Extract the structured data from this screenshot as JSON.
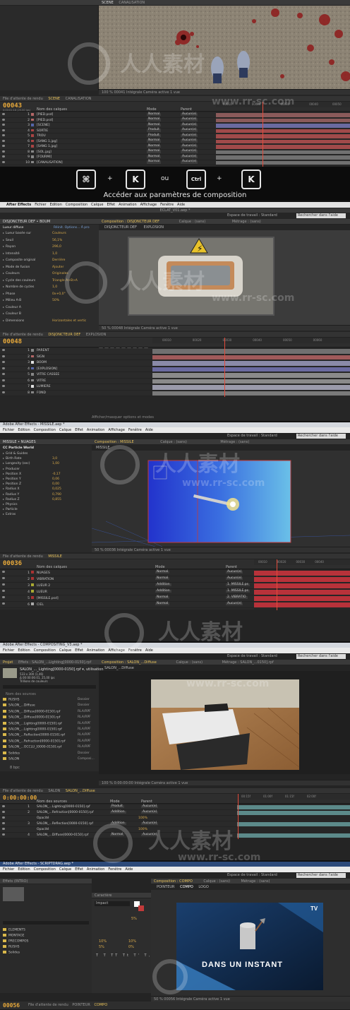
{
  "shot1": {
    "viewer_tabs": [
      "SCENE",
      "CANALISATION"
    ],
    "viewer_bar": "100 %   00041   Intégrale   Caméra active   1 vue",
    "timeline_tabs": [
      "File d'attente de rendu",
      "SCENE",
      "CANALISATION"
    ],
    "timecode": "00043",
    "timecode_sub": "0:00:01:18 (25.00 ips)",
    "col_headers": {
      "name": "Nom des calques",
      "mode": "Mode",
      "parent": "Parent"
    },
    "layers": [
      {
        "num": "1",
        "name": "[PIED.psd]",
        "mode": "Normal",
        "parent": "Aucun(e)",
        "color": "#b36666"
      },
      {
        "num": "2",
        "name": "[PIED.psd]",
        "mode": "Normal",
        "parent": "Aucun(e)",
        "color": "#b36666"
      },
      {
        "num": "3",
        "name": "[SCENE]",
        "mode": "Normal",
        "parent": "Aucun(e)",
        "color": "#5566aa"
      },
      {
        "num": "4",
        "name": "SORTIE",
        "mode": "Produit",
        "parent": "Aucun(e)",
        "color": "#aa4444"
      },
      {
        "num": "5",
        "name": "TROU",
        "mode": "Produit",
        "parent": "Aucun(e)",
        "color": "#aa4444"
      },
      {
        "num": "6",
        "name": "[SANG 1.jpg]",
        "mode": "Normal",
        "parent": "Aucun(e)",
        "color": "#aa4444"
      },
      {
        "num": "7",
        "name": "[SANG 1.jpg]",
        "mode": "Normal",
        "parent": "Aucun(e)",
        "color": "#aa4444"
      },
      {
        "num": "8",
        "name": "[SOL.jpg]",
        "mode": "Normal",
        "parent": "Aucun(e)",
        "color": "#888888"
      },
      {
        "num": "9",
        "name": "[FOURMI]",
        "mode": "Normal",
        "parent": "Aucun(e)",
        "color": "#888888"
      },
      {
        "num": "10",
        "name": "[CANALISATION]",
        "mode": "Normal",
        "parent": "Aucun(e)",
        "color": "#888888"
      }
    ],
    "bar_colors": [
      "#8a5a5a",
      "#8a5a5a",
      "#6a6aa0",
      "#a04a4a",
      "#a04a4a",
      "#a04a4a",
      "#a04a4a",
      "#707070",
      "#707070",
      "#707070"
    ],
    "shortcut": {
      "keys": [
        "⌘",
        "K",
        "Ctrl",
        "K"
      ],
      "plus": "+",
      "or": "ou",
      "caption": "Accéder aux paramètres de composition"
    }
  },
  "shot2": {
    "menu": [
      "",
      "After Effects",
      "Fichier",
      "Edition",
      "Composition",
      "Calque",
      "Effet",
      "Animation",
      "Affichage",
      "Fenêtre",
      "Aide"
    ],
    "title": "ECLAT_V01.aep *",
    "workspace": "Espace de travail : Standard",
    "search": "Rechercher dans l'aide",
    "effects_tab": "DISJONCTEUR DEF • BOUM",
    "viewer_tabs": [
      "Composition : DISJONCTEUR DEF",
      "Calque : (sans)",
      "Métrage : (sans)"
    ],
    "viewer_subtabs": [
      "DISJONCTEUR DEF",
      "EXPLOSION"
    ],
    "effect_name": "Lueur diffuse",
    "effect_links": "Réinit.  Options...  À pro",
    "properties": [
      {
        "name": "Lueur basée sur",
        "value": "Couleurs"
      },
      {
        "name": "Seuil",
        "value": "56,1%"
      },
      {
        "name": "Rayon",
        "value": "296,0"
      },
      {
        "name": "Intensité",
        "value": "1,0"
      },
      {
        "name": "Composite original",
        "value": "Derrière"
      },
      {
        "name": "Mode de fusion",
        "value": "Ajouter"
      },
      {
        "name": "Couleurs",
        "value": "Originales"
      },
      {
        "name": "Cycle des couleurs",
        "value": "Triangle A>B>A"
      },
      {
        "name": "Nombre de cycles",
        "value": "1,0"
      },
      {
        "name": "Phase",
        "value": "0x+0,0°"
      },
      {
        "name": "Milieu A-B",
        "value": "50%"
      },
      {
        "name": "Couleur A",
        "value": ""
      },
      {
        "name": "Couleur B",
        "value": ""
      },
      {
        "name": "Dimensions",
        "value": "Horizontales et vertic"
      }
    ],
    "viewer_bar": "50 %   00048   Intégrale   Caméra active   1 vue",
    "timeline_tabs": [
      "File d'attente de rendu",
      "DISJONCTEUR DEF",
      "EXPLOSION"
    ],
    "timecode": "00048",
    "layers": [
      {
        "num": "1",
        "name": "PARENT",
        "color": "#888888"
      },
      {
        "num": "2",
        "name": "SIGN",
        "color": "#b36666"
      },
      {
        "num": "3",
        "name": "BOOM",
        "color": "#e0e0e0"
      },
      {
        "num": "4",
        "name": "[EXPLOSION]",
        "color": "#5566aa"
      },
      {
        "num": "5",
        "name": "VITRE CASSEE",
        "color": "#888888"
      },
      {
        "num": "6",
        "name": "VITRE",
        "color": "#888888"
      },
      {
        "num": "7",
        "name": "LUMIERE",
        "color": "#e0e0e0"
      },
      {
        "num": "8",
        "name": "FOND",
        "color": "#888888"
      }
    ],
    "bar_colors": [
      "#707070",
      "#a05a5a",
      "#8a8aa8",
      "#6a6aa0",
      "#8a8a8a",
      "#8a8a8a",
      "#9a9aaa",
      "#7a7a7a"
    ],
    "footer": "Afficher/masquer options et modes"
  },
  "shot3": {
    "title": "Adobe After Effects - MISSILE.aep *",
    "menu": [
      "Fichier",
      "Edition",
      "Composition",
      "Calque",
      "Effet",
      "Animation",
      "Affichage",
      "Fenêtre",
      "Aide"
    ],
    "workspace": "Espace de travail : Standard",
    "search": "Rechercher dans l'aide",
    "effects_tab": "MISSILE • NUAGES",
    "effect_name": "CC Particle World",
    "properties": [
      {
        "name": "Grid & Guides",
        "value": ""
      },
      {
        "name": "Birth Rate",
        "value": "3,0"
      },
      {
        "name": "Longevity (sec)",
        "value": "1,00"
      },
      {
        "name": "Producer",
        "value": ""
      },
      {
        "name": "Position X",
        "value": "-0,17"
      },
      {
        "name": "Position Y",
        "value": "0,06"
      },
      {
        "name": "Position Z",
        "value": "0,00"
      },
      {
        "name": "Radius X",
        "value": "0,025"
      },
      {
        "name": "Radius Y",
        "value": "0,790"
      },
      {
        "name": "Radius Z",
        "value": "0,855"
      },
      {
        "name": "Physics",
        "value": ""
      },
      {
        "name": "Particle",
        "value": ""
      },
      {
        "name": "Extras",
        "value": ""
      }
    ],
    "viewer_tabs": [
      "Composition : MISSILE",
      "Calque : (sans)",
      "Métrage : (sans)"
    ],
    "viewer_subtab": "MISSILE",
    "viewer_bar": "50 %   00036   Intégrale   Caméra active   1 vue",
    "timeline_tabs": [
      "File d'attente de rendu",
      "MISSILE"
    ],
    "timecode": "00036",
    "col_headers": {
      "name": "Nom des calques",
      "mode": "Mode",
      "parent": "Parent"
    },
    "layers": [
      {
        "num": "1",
        "name": "NUAGES",
        "mode": "Normal",
        "parent": "Aucun(e)",
        "color": "#aa3333"
      },
      {
        "num": "2",
        "name": "VIBRATION",
        "mode": "Normal",
        "parent": "Aucun(e)",
        "color": "#aa3333"
      },
      {
        "num": "3",
        "name": "LUEUR 2",
        "mode": "Addition",
        "parent": "1. MISSILE.ps",
        "color": "#aaaa33"
      },
      {
        "num": "4",
        "name": "LUEUR",
        "mode": "Addition",
        "parent": "1. MISSILE.ps",
        "color": "#aaaa33"
      },
      {
        "num": "5",
        "name": "[MISSILE.psd]",
        "mode": "Normal",
        "parent": "2. VIBRATIO",
        "color": "#aa3333"
      },
      {
        "num": "6",
        "name": "CIEL",
        "mode": "Normal",
        "parent": "Aucun(e)",
        "color": "#aaaaaa"
      }
    ],
    "bar_colors": [
      "#b8323a",
      "#b8323a",
      "#b8323a",
      "#b8323a",
      "#b8323a",
      "#b8323a"
    ]
  },
  "shot4": {
    "title": "Adobe After Effects - COMPOSITING_V3.aep *",
    "menu": [
      "Fichier",
      "Edition",
      "Composition",
      "Calque",
      "Effet",
      "Animation",
      "Affichage",
      "Fenêtre",
      "Aide"
    ],
    "workspace": "Espace de travail : Standard",
    "search": "Rechercher dans l'aide",
    "project_tab": "Projet",
    "effects_tab": "Effets : SALON_...Lighting[0000-0150].rpf",
    "project_item": "SALON_..._Lighting[0000-0150].rpf ▾, utilisation",
    "project_info": [
      "533 x 300 (1,46)",
      "Δ 00:00:06:01, 25,00 ips",
      "Trillions de couleurs"
    ],
    "col_headers": {
      "name": "Nom des sources",
      "mode": "Mode",
      "parent": "Parent"
    },
    "items": [
      {
        "name": "RUSHS",
        "type": "Dossier"
      },
      {
        "name": "SALON_...Diffuse",
        "type": "Dossier"
      },
      {
        "name": "SALON_...Diffuse[0000-0150].rpf",
        "type": "RLA/RPF"
      },
      {
        "name": "SALON_...Diffuse[0000-0150].rpf",
        "type": "RLA/RPF"
      },
      {
        "name": "SALON_...Lighting[0000-0150].rpf",
        "type": "RLA/RPF"
      },
      {
        "name": "SALON_...Lighting[0000-0150].rpf",
        "type": "RLA/RPF"
      },
      {
        "name": "SALON_...Reflection[0000-0150].rpf",
        "type": "RLA/RPF"
      },
      {
        "name": "SALON_...Refraction[0000-0150].rpf",
        "type": "RLA/RPF"
      },
      {
        "name": "SALON_...OCCLU_[0000-0150].rpf",
        "type": "RLA/RPF"
      },
      {
        "name": "Solides",
        "type": "Dossier"
      },
      {
        "name": "SALON",
        "type": "Composi..."
      }
    ],
    "footer": "8 bpc",
    "viewer_tabs": [
      "Composition : SALON_...Diffuse",
      "Calque : (sans)",
      "Métrage : SALON_...0150].rpf"
    ],
    "viewer_subtab": "SALON_...Diffuse",
    "viewer_bar": "100 %   0:00:00:00   Intégrale   Caméra active   1 vue",
    "timeline_tabs": [
      "File d'attente de rendu",
      "SALON",
      "SALON_...Diffuse"
    ],
    "timecode": "0:00:00:00",
    "layers": [
      {
        "num": "1",
        "name": "SALON_...Lighting[0000-0150].rpf",
        "mode": "Produit",
        "parent": "Aucun(e)"
      },
      {
        "num": "2",
        "name": "SALON_...Refraction[0000-0150].rpf",
        "mode": "Addition",
        "parent": "Aucun(e)"
      },
      {
        "num": "",
        "name": "Opacité",
        "mode": "",
        "parent": "",
        "value": "100%"
      },
      {
        "num": "3",
        "name": "SALON_...Reflection[0000-0150].rpf",
        "mode": "Addition",
        "parent": "Aucun(e)"
      },
      {
        "num": "",
        "name": "Opacité",
        "mode": "",
        "parent": "",
        "value": "100%"
      },
      {
        "num": "4",
        "name": "SALON_...Diffuse[0000-0150].rpf",
        "mode": "Normal",
        "parent": "Aucun(e)"
      }
    ],
    "bar_colors": [
      "#5c8a8a",
      "#5c8a8a",
      "#262626",
      "#5c8a8a",
      "#262626",
      "#5c8a8a"
    ]
  },
  "shot5": {
    "title": "Adobe After Effects - SCRIPTDRAG.aep *",
    "menu": [
      "Fichier",
      "Edition",
      "Composition",
      "Calque",
      "Effet",
      "Animation",
      "Fenêtre",
      "Aide"
    ],
    "workspace": "Espace de travail : Standard",
    "search": "Rechercher dans l'aide",
    "effects_tab": "Effets (INTRO)",
    "char_tab": "Caractère",
    "font_name": "Impact",
    "font_values": [
      "5%",
      "10%",
      "10%",
      "5%",
      "0%"
    ],
    "project_items": [
      {
        "name": "ELEMENTS",
        "color": "#d9b84a"
      },
      {
        "name": "MONTAGE",
        "color": "#d9b84a"
      },
      {
        "name": "PRECOMPOS",
        "color": "#d9b84a"
      },
      {
        "name": "RUSHS",
        "color": "#d9b84a"
      },
      {
        "name": "Solides",
        "color": "#d9b84a"
      }
    ],
    "viewer_tabs": [
      "Composition : COMPO",
      "Calque : (sans)",
      "Métrage : (sans)"
    ],
    "viewer_subtabs": [
      "POINTEUR",
      "COMPO",
      "LOGO"
    ],
    "viewer_text": "DANS UN INSTANT",
    "corner_text": "TV",
    "viewer_bar": "50 %   00056   Intégrale   Caméra active   1 vue",
    "timecode": "00056",
    "timeline_tabs": [
      "File d'attente de rendu",
      "POINTEUR",
      "COMPO"
    ]
  },
  "watermark": {
    "main": "人人素材",
    "url": "www.rr-sc.com"
  },
  "colors": {
    "accent_orange": "#e8a93a",
    "ae_bg": "#2a2a2a",
    "cti_red": "#e34b3b"
  }
}
